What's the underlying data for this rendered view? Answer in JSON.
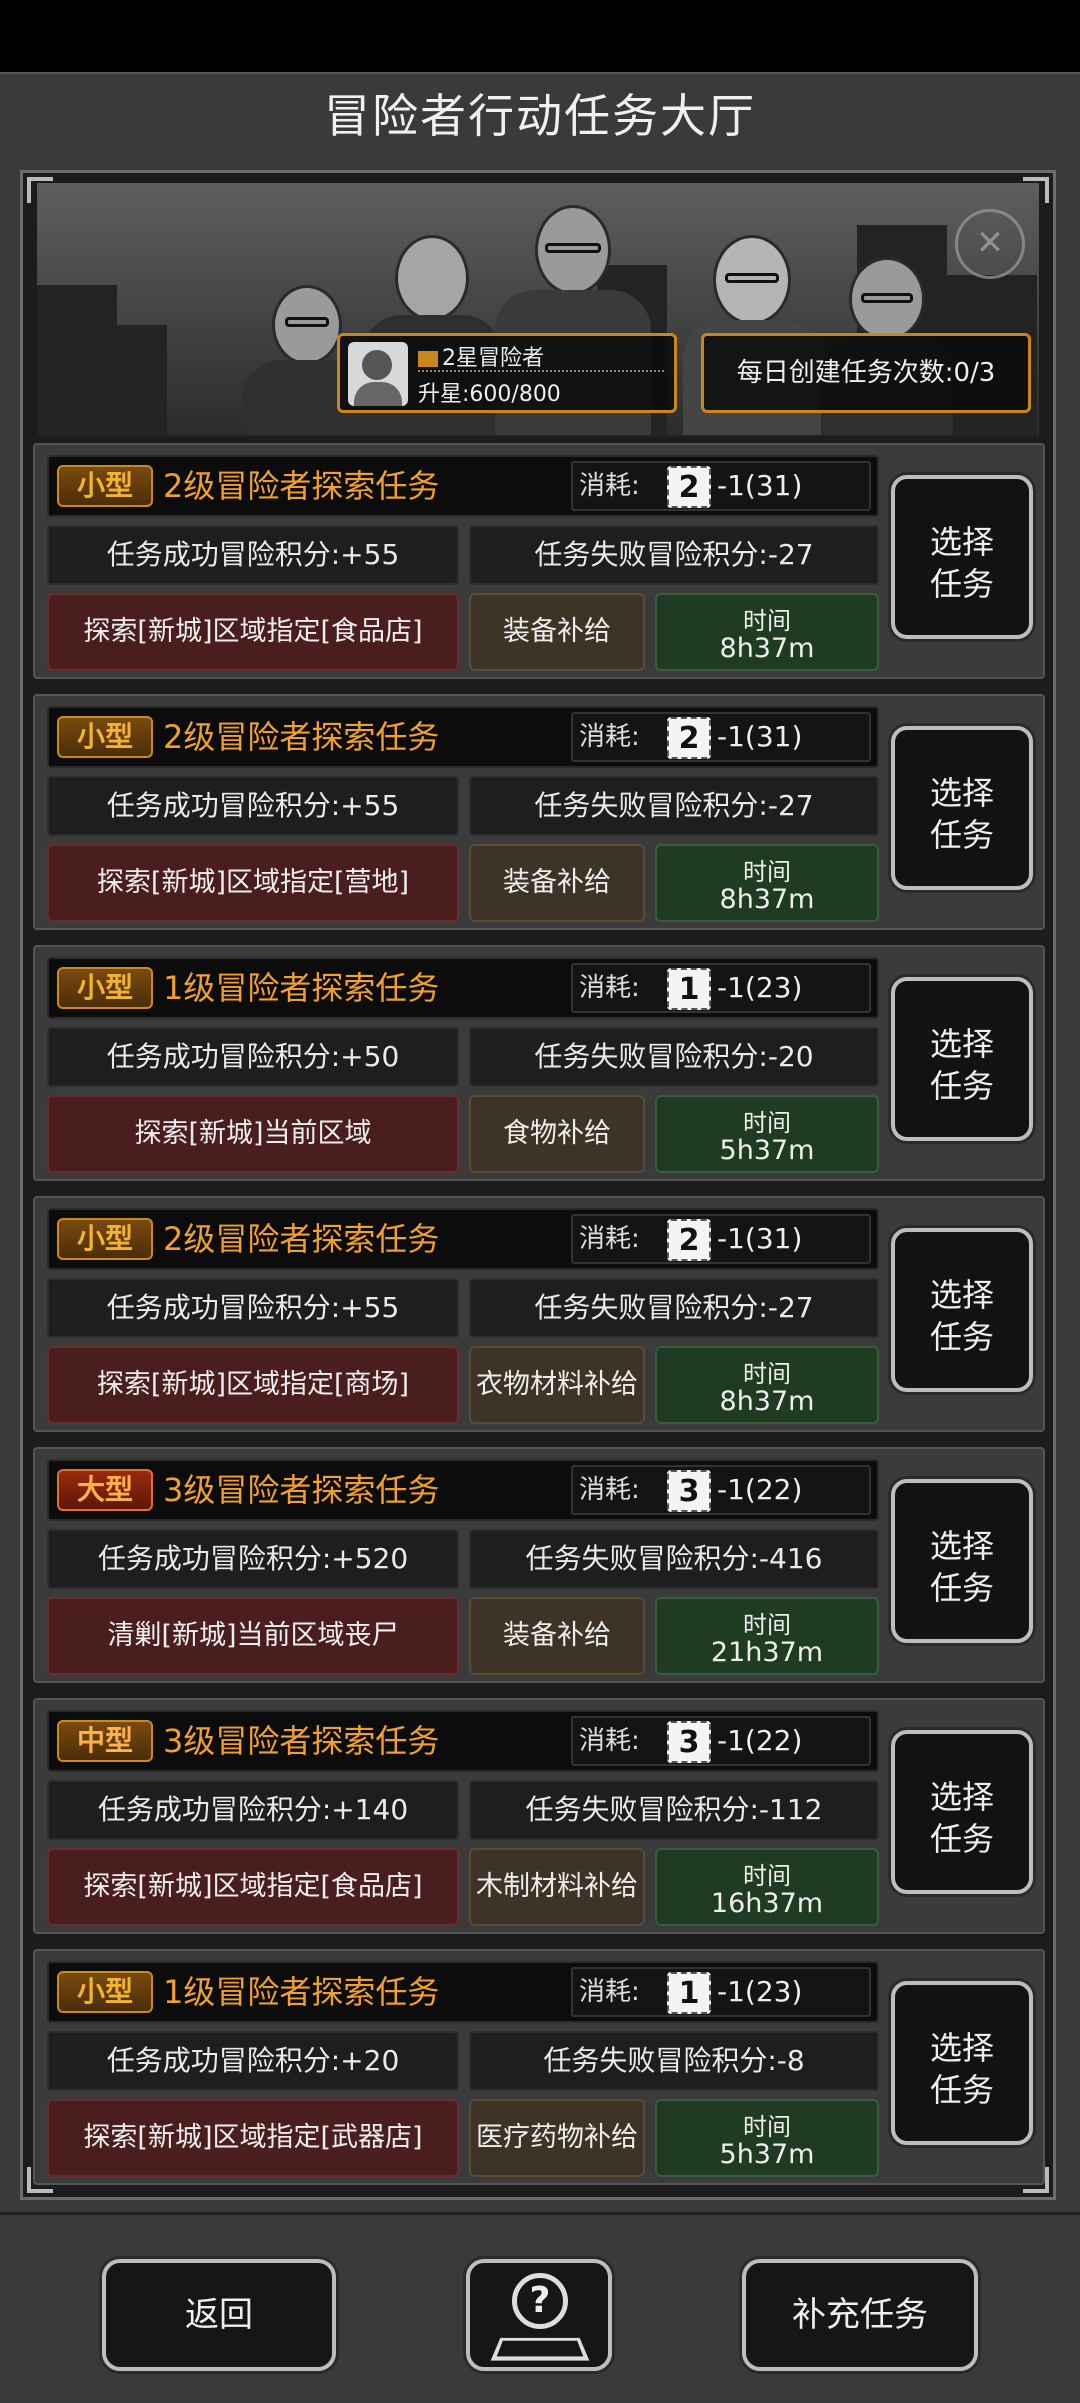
{
  "header": {
    "title": "冒险者行动任务大厅"
  },
  "rank": {
    "name": "2星冒险者",
    "progress": "升星:600/800"
  },
  "daily": {
    "label": "每日创建任务次数:0/3"
  },
  "cost_label": "消耗:",
  "time_label": "时间",
  "select_line1": "选择",
  "select_line2": "任务",
  "tasks": [
    {
      "size": "小型",
      "size_kind": "small",
      "title": "2级冒险者探索任务",
      "level": "2",
      "cost": "-1(31)",
      "success": "任务成功冒险积分:+55",
      "fail": "任务失败冒险积分:-27",
      "target": "探索[新城]区域指定[食品店]",
      "supply": "装备补给",
      "time": "8h37m"
    },
    {
      "size": "小型",
      "size_kind": "small",
      "title": "2级冒险者探索任务",
      "level": "2",
      "cost": "-1(31)",
      "success": "任务成功冒险积分:+55",
      "fail": "任务失败冒险积分:-27",
      "target": "探索[新城]区域指定[营地]",
      "supply": "装备补给",
      "time": "8h37m"
    },
    {
      "size": "小型",
      "size_kind": "small",
      "title": "1级冒险者探索任务",
      "level": "1",
      "cost": "-1(23)",
      "success": "任务成功冒险积分:+50",
      "fail": "任务失败冒险积分:-20",
      "target": "探索[新城]当前区域",
      "supply": "食物补给",
      "time": "5h37m"
    },
    {
      "size": "小型",
      "size_kind": "small",
      "title": "2级冒险者探索任务",
      "level": "2",
      "cost": "-1(31)",
      "success": "任务成功冒险积分:+55",
      "fail": "任务失败冒险积分:-27",
      "target": "探索[新城]区域指定[商场]",
      "supply": "衣物材料补给",
      "time": "8h37m"
    },
    {
      "size": "大型",
      "size_kind": "large",
      "title": "3级冒险者探索任务",
      "level": "3",
      "cost": "-1(22)",
      "success": "任务成功冒险积分:+520",
      "fail": "任务失败冒险积分:-416",
      "target": "清剿[新城]当前区域丧尸",
      "supply": "装备补给",
      "time": "21h37m"
    },
    {
      "size": "中型",
      "size_kind": "medium",
      "title": "3级冒险者探索任务",
      "level": "3",
      "cost": "-1(22)",
      "success": "任务成功冒险积分:+140",
      "fail": "任务失败冒险积分:-112",
      "target": "探索[新城]区域指定[食品店]",
      "supply": "木制材料补给",
      "time": "16h37m"
    },
    {
      "size": "小型",
      "size_kind": "small",
      "title": "1级冒险者探索任务",
      "level": "1",
      "cost": "-1(23)",
      "success": "任务成功冒险积分:+20",
      "fail": "任务失败冒险积分:-8",
      "target": "探索[新城]区域指定[武器店]",
      "supply": "医疗药物补给",
      "time": "5h37m"
    }
  ],
  "footer": {
    "back_label": "返回",
    "help_icon": "help-map-icon",
    "refill_label": "补充任务"
  }
}
